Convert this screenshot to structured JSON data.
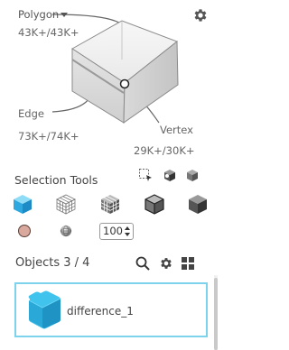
{
  "topology": {
    "polygon_label": "Polygon",
    "polygon_count": "43K+/43K+",
    "edge_label": "Edge",
    "edge_count": "73K+/74K+",
    "vertex_label": "Vertex",
    "vertex_count": "29K+/30K+"
  },
  "selection_tools": {
    "title": "Selection Tools",
    "number_value": "100"
  },
  "objects": {
    "title": "Objects 3 / 4",
    "items": [
      {
        "name": "difference_1"
      }
    ]
  },
  "colors": {
    "accent": "#2fa8e0",
    "item_border": "#7dd3ec",
    "object_thumb": "#40c4ee",
    "swatch": "#d9a99d"
  },
  "icons": {
    "settings": "gear-icon",
    "search": "search-icon",
    "grid": "grid-view-icon"
  }
}
